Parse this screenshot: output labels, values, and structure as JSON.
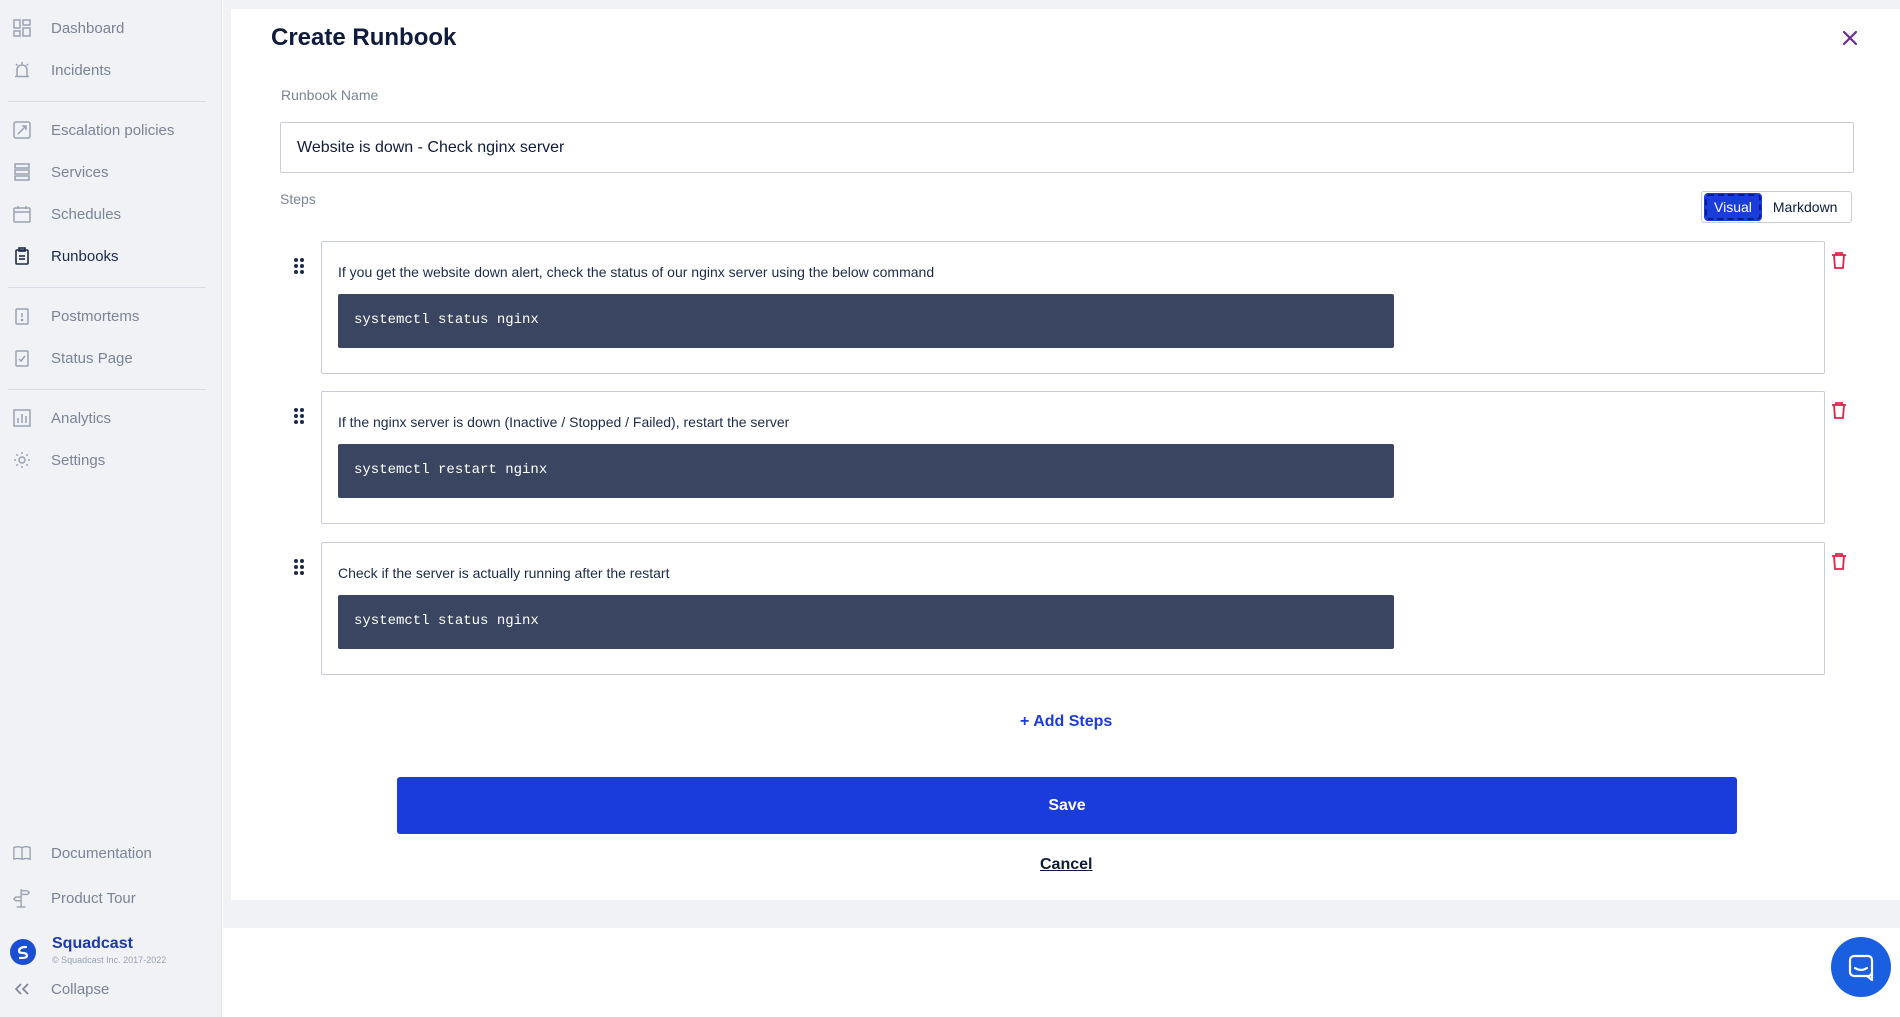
{
  "sidebar": {
    "items": [
      {
        "label": "Dashboard",
        "icon": "dashboard-icon"
      },
      {
        "label": "Incidents",
        "icon": "incidents-icon"
      },
      {
        "label": "Escalation policies",
        "icon": "escalation-icon"
      },
      {
        "label": "Services",
        "icon": "services-icon"
      },
      {
        "label": "Schedules",
        "icon": "calendar-icon"
      },
      {
        "label": "Runbooks",
        "icon": "clipboard-icon",
        "active": true
      },
      {
        "label": "Postmortems",
        "icon": "postmortem-icon"
      },
      {
        "label": "Status Page",
        "icon": "status-page-icon"
      },
      {
        "label": "Analytics",
        "icon": "analytics-icon"
      },
      {
        "label": "Settings",
        "icon": "gear-icon"
      }
    ],
    "footer": {
      "documentation": "Documentation",
      "product_tour": "Product Tour",
      "brand_name": "Squadcast",
      "brand_copy": "© Squadcast Inc. 2017-2022",
      "collapse": "Collapse"
    }
  },
  "form": {
    "title": "Create Runbook",
    "name_label": "Runbook Name",
    "name_value": "Website is down - Check nginx server",
    "steps_label": "Steps",
    "toggle": {
      "visual": "Visual",
      "markdown": "Markdown",
      "selected": "Visual"
    },
    "steps": [
      {
        "text": "If you get the website down alert, check the status of our nginx server using the below command",
        "code": "systemctl status nginx"
      },
      {
        "text": "If the nginx server is down (Inactive / Stopped / Failed), restart the server",
        "code": "systemctl restart nginx"
      },
      {
        "text": "Check if the server is actually running after the restart",
        "code": "systemctl status nginx"
      }
    ],
    "add_steps": "+ Add Steps",
    "save": "Save",
    "cancel": "Cancel"
  },
  "colors": {
    "accent": "#1a3cdc",
    "code_bg": "#3a4661",
    "danger": "#e0244a",
    "close": "#6a2c91"
  }
}
